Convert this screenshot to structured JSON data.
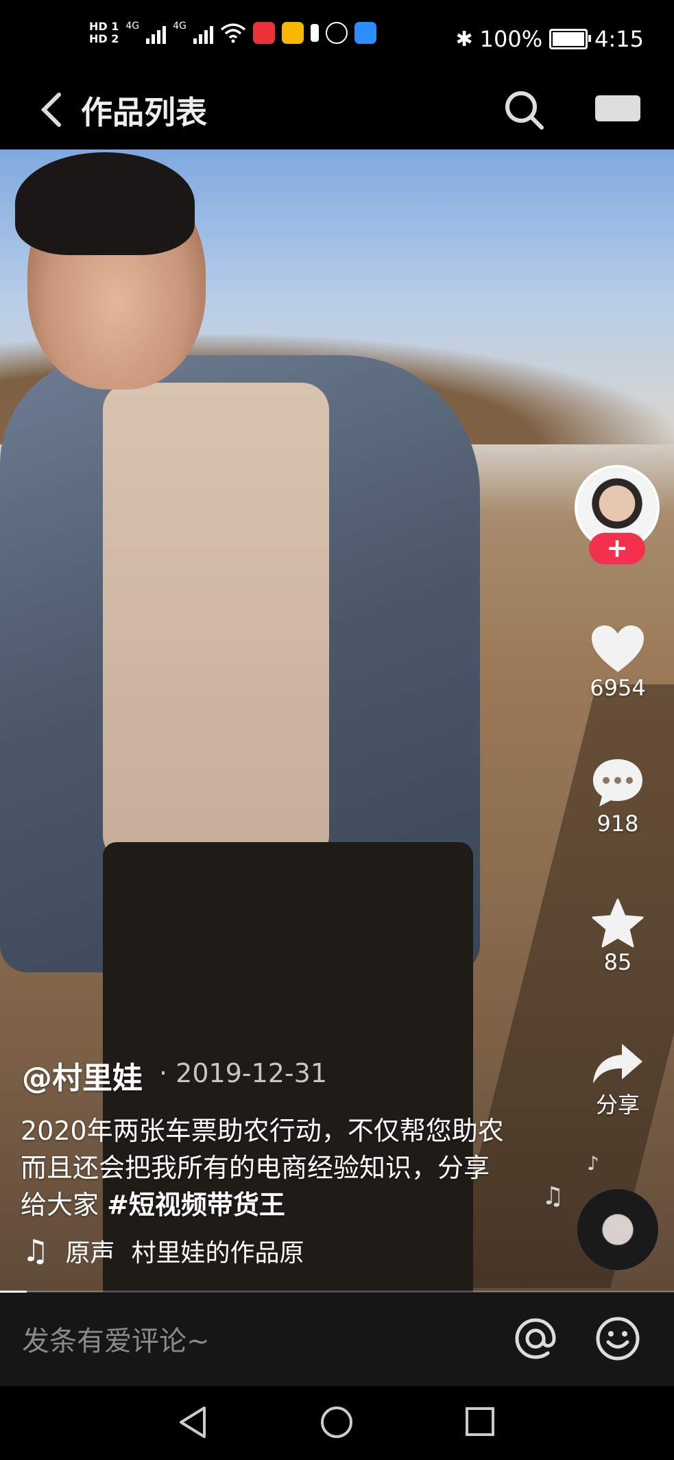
{
  "status_bar": {
    "hd1": "HD 1",
    "hd2": "HD 2",
    "net1": "4G",
    "net2": "4G",
    "battery_text": "100%",
    "battery_level": 1.0,
    "time": "4:15"
  },
  "header": {
    "title": "作品列表"
  },
  "video": {
    "author": "@村里娃",
    "date": "· 2019-12-31",
    "description": "2020年两张车票助农行动，不仅帮您助农而且还会把我所有的电商经验知识，分享给大家 ",
    "hashtag": "#短视频带货王",
    "music_prefix": "原声",
    "music_title": "村里娃的作品原",
    "progress": 0.04
  },
  "actions": {
    "follow": "+",
    "likes": "6954",
    "comments": "918",
    "favorites": "85",
    "share": "分享"
  },
  "comment_bar": {
    "placeholder": "发条有爱评论~"
  },
  "colors": {
    "follow_red": "#f3304d",
    "bar_dark": "#161616"
  }
}
